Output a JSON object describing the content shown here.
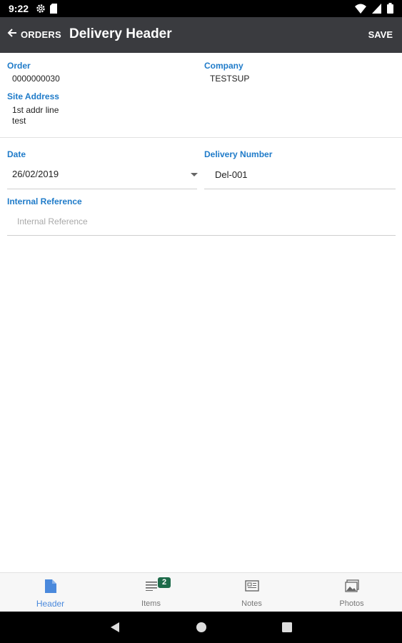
{
  "status_bar": {
    "time": "9:22"
  },
  "app_bar": {
    "back_label": "ORDERS",
    "title": "Delivery Header",
    "save_label": "SAVE"
  },
  "order": {
    "label": "Order",
    "value": "0000000030"
  },
  "company": {
    "label": "Company",
    "value": "TESTSUP"
  },
  "site_address": {
    "label": "Site Address",
    "line1": "1st addr line",
    "line2": "test"
  },
  "date": {
    "label": "Date",
    "value": "26/02/2019"
  },
  "delivery_number": {
    "label": "Delivery Number",
    "value": "Del-001"
  },
  "internal_reference": {
    "label": "Internal Reference",
    "placeholder": "Internal Reference"
  },
  "bottom_nav": {
    "items": [
      {
        "label": "Header",
        "icon": "document-icon",
        "active": true
      },
      {
        "label": "Items",
        "icon": "list-icon",
        "badge": "2"
      },
      {
        "label": "Notes",
        "icon": "notes-icon"
      },
      {
        "label": "Photos",
        "icon": "photos-icon"
      }
    ]
  },
  "colors": {
    "accent": "#1f7bc9",
    "app_bar": "#3a3b3f",
    "badge": "#1e6b4a",
    "active_tab": "#4a89dc"
  }
}
